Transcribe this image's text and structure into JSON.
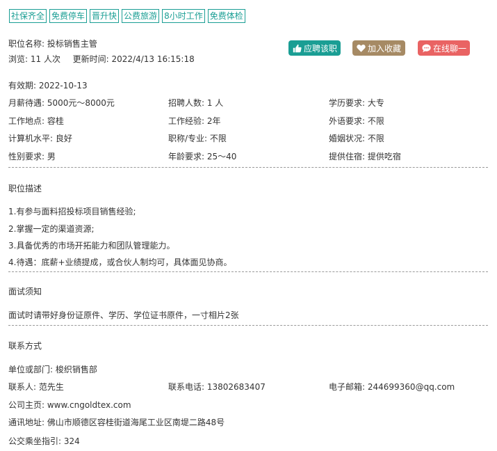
{
  "tags": [
    "社保齐全",
    "免费停车",
    "晋升快",
    "公费旅游",
    "8小时工作",
    "免费体检"
  ],
  "job": {
    "title_label": "职位名称:",
    "title_value": "投标销售主管",
    "views_label": "浏览:",
    "views_value": "11 人次",
    "updated_label": "更新时间:",
    "updated_value": "2022/4/13 16:15:18"
  },
  "actions": {
    "apply": "应聘该职",
    "favorite": "加入收藏",
    "chat": "在线聊一"
  },
  "details": {
    "validity": "有效期:  2022-10-13",
    "rows": [
      [
        "月薪待遇:  5000元～8000元",
        "招聘人数:  1 人",
        "学历要求:  大专"
      ],
      [
        "工作地点:  容桂",
        "工作经验:  2年",
        "外语要求:  不限"
      ],
      [
        "计算机水平:  良好",
        "职称/专业:  不限",
        "婚姻状况:  不限"
      ],
      [
        "性别要求:  男",
        "年龄要求:  25～40",
        "提供住宿:  提供吃宿"
      ]
    ]
  },
  "description": {
    "title": "职位描述",
    "lines": [
      "1.有参与面料招投标项目销售经验;",
      "2.掌握一定的渠道资源;",
      "3.具备优秀的市场开拓能力和团队管理能力。",
      "4.待遇：底薪+业绩提成，或合伙人制均可，具体面见协商。"
    ]
  },
  "interview": {
    "title": "面试须知",
    "text": "面试时请带好身份证原件、学历、学位证书原件，一寸相片2张"
  },
  "contact": {
    "title": "联系方式",
    "department": "单位或部门:  梭织销售部",
    "person": "联系人:  范先生",
    "phone": "联系电话:  13802683407",
    "email": "电子邮箱:  244699360@qq.com",
    "homepage": "公司主页:  www.cngoldtex.com",
    "address": "通讯地址:  佛山市顺德区容桂街道海尾工业区南堤二路48号",
    "bus": "公交乘坐指引:  324"
  },
  "colors": {
    "accent": "#1a9e94",
    "favorite": "#a68a64",
    "chat": "#e96363",
    "text": "#333333"
  }
}
